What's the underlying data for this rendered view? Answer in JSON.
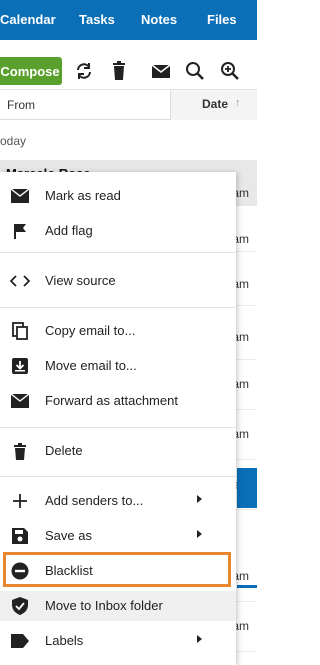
{
  "nav": {
    "items": [
      "Calendar",
      "Tasks",
      "Notes",
      "Files"
    ]
  },
  "toolbar": {
    "compose_label": "Compose",
    "icons": [
      "refresh-icon",
      "trash-icon",
      "envelope-icon",
      "search-icon",
      "zoom-in-icon"
    ]
  },
  "list": {
    "col_from": "From",
    "col_date": "Date",
    "group_label": "oday",
    "first_sender": "Marcelo Rose",
    "time_suffix": "am"
  },
  "context_menu": {
    "items": [
      {
        "label": "Mark as read",
        "icon": "envelope-icon"
      },
      {
        "label": "Add flag",
        "icon": "flag-icon"
      },
      {
        "label": "View source",
        "icon": "code-icon"
      },
      {
        "label": "Copy email to...",
        "icon": "copy-icon"
      },
      {
        "label": "Move email to...",
        "icon": "move-icon"
      },
      {
        "label": "Forward as attachment",
        "icon": "envelope-icon"
      },
      {
        "label": "Delete",
        "icon": "trash-icon"
      },
      {
        "label": "Add senders to...",
        "icon": "plus-icon",
        "submenu": true
      },
      {
        "label": "Save as",
        "icon": "save-icon",
        "submenu": true
      },
      {
        "label": "Blacklist",
        "icon": "blacklist-icon"
      },
      {
        "label": "Move to Inbox folder",
        "icon": "shield-check-icon"
      },
      {
        "label": "Labels",
        "icon": "label-icon",
        "submenu": true
      }
    ]
  },
  "colors": {
    "nav": "#0b6fb7",
    "compose": "#5aa02c",
    "focus": "#e8872f"
  }
}
